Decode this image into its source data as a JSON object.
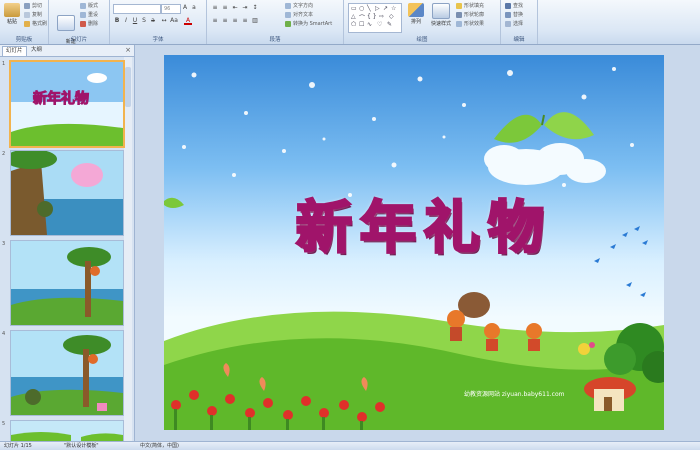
{
  "ribbon": {
    "clipboard": {
      "paste": "粘贴",
      "cut": "剪切",
      "copy": "复制",
      "format_painter": "格式刷",
      "group_label": "剪贴板"
    },
    "slides": {
      "new_slide": "新建\n幻灯片",
      "layout": "版式",
      "reset": "重设",
      "delete": "删除",
      "group_label": "幻灯片"
    },
    "font": {
      "font_name": "",
      "font_size": "96",
      "group_label": "字体"
    },
    "paragraph": {
      "text_direction": "文字方向",
      "align_text": "对齐文本",
      "convert_smartart": "转换为 SmartArt",
      "group_label": "段落"
    },
    "drawing": {
      "arrange": "排列",
      "quick_styles": "快速样式",
      "shape_fill": "形状填充",
      "shape_outline": "形状轮廓",
      "shape_effects": "形状效果",
      "group_label": "绘图"
    },
    "editing": {
      "find": "查找",
      "replace": "替换",
      "select": "选择",
      "group_label": "编辑"
    }
  },
  "panel": {
    "tab_slides": "幻灯片",
    "tab_outline": "大纲",
    "close": "×",
    "slide_numbers": [
      "1",
      "2",
      "3",
      "4",
      "5"
    ],
    "thumb1_title": "新年礼物"
  },
  "slide": {
    "title": "新年礼物",
    "watermark": "幼教资源网站  ziyuan.baby611.com"
  },
  "status": {
    "slide_info": "幻灯片 1/15",
    "theme": "\"默认设计模板\"",
    "language": "中文(简体，中国)"
  },
  "colors": {
    "title_stroke": "#a0146a",
    "title_fill": "#fde4f3",
    "sky_top": "#3a8bd9",
    "grass": "#6cbf2e",
    "selection": "#f2b34e"
  }
}
